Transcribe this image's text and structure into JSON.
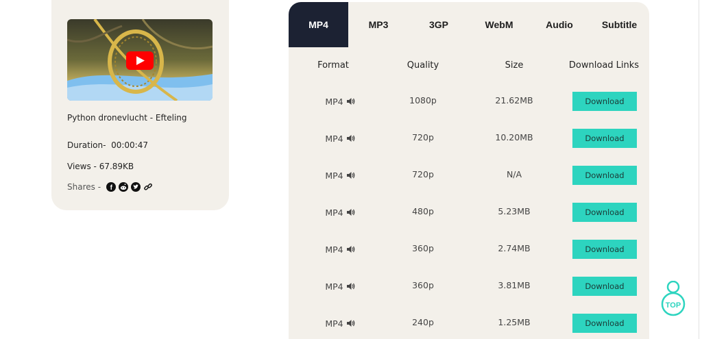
{
  "video": {
    "title": "Python dronevlucht - Efteling",
    "duration_label": "Duration-",
    "duration": "00:00:47",
    "views": "Views - 67.89KB",
    "shares_label": "Shares -"
  },
  "tabs": [
    {
      "label": "MP4",
      "active": true
    },
    {
      "label": "MP3",
      "active": false
    },
    {
      "label": "3GP",
      "active": false
    },
    {
      "label": "WebM",
      "active": false
    },
    {
      "label": "Audio",
      "active": false
    },
    {
      "label": "Subtitle",
      "active": false
    }
  ],
  "table": {
    "headers": {
      "format": "Format",
      "quality": "Quality",
      "size": "Size",
      "links": "Download Links"
    },
    "rows": [
      {
        "format": "MP4",
        "quality": "1080p",
        "size": "21.62MB",
        "button": "Download"
      },
      {
        "format": "MP4",
        "quality": "720p",
        "size": "10.20MB",
        "button": "Download"
      },
      {
        "format": "MP4",
        "quality": "720p",
        "size": "N/A",
        "button": "Download"
      },
      {
        "format": "MP4",
        "quality": "480p",
        "size": "5.23MB",
        "button": "Download"
      },
      {
        "format": "MP4",
        "quality": "360p",
        "size": "2.74MB",
        "button": "Download"
      },
      {
        "format": "MP4",
        "quality": "360p",
        "size": "3.81MB",
        "button": "Download"
      },
      {
        "format": "MP4",
        "quality": "240p",
        "size": "1.25MB",
        "button": "Download"
      }
    ]
  },
  "scroll_top": {
    "label": "TOP"
  },
  "colors": {
    "active_tab": "#1c2233",
    "download_button": "#2dd4bf",
    "card_bg": "#f3f0ea",
    "youtube_red": "#ff0000"
  },
  "icons": [
    "youtube-play-icon",
    "speaker-icon",
    "facebook-icon",
    "reddit-icon",
    "twitter-icon",
    "link-icon"
  ]
}
